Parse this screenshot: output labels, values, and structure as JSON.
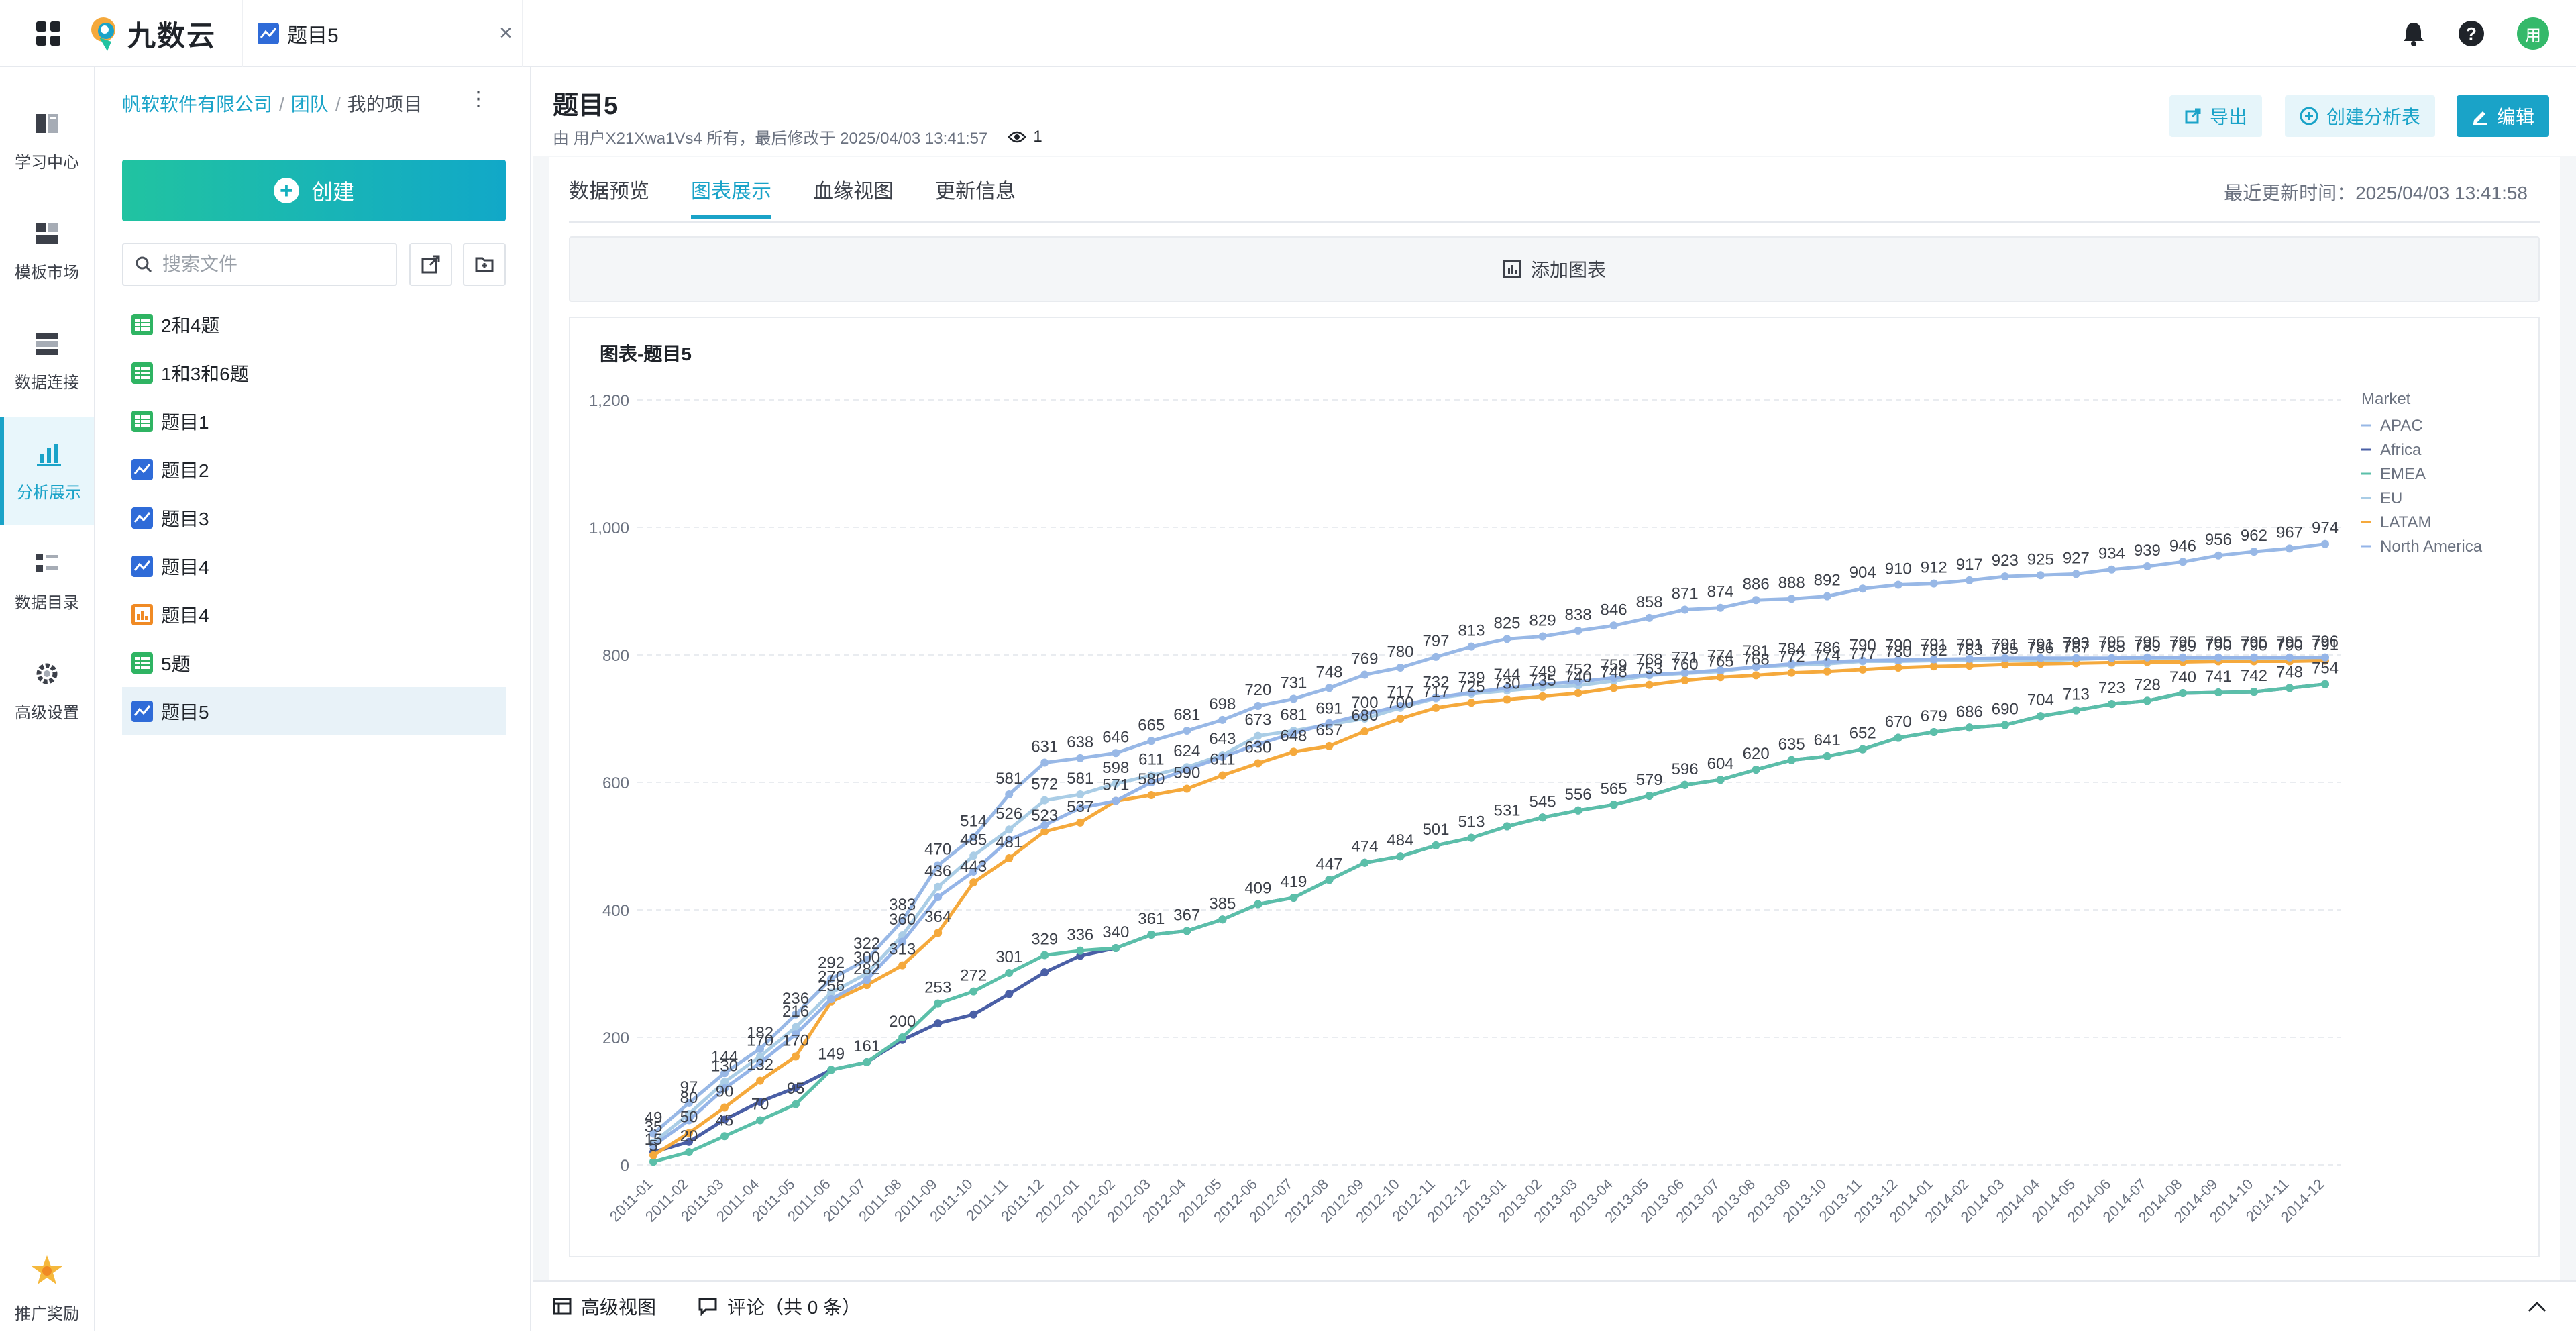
{
  "app": {
    "logo_text": "九数云",
    "tab_title": "题目5"
  },
  "rail": {
    "items": [
      {
        "label": "学习中心",
        "icon": "book-icon"
      },
      {
        "label": "模板市场",
        "icon": "template-icon"
      },
      {
        "label": "数据连接",
        "icon": "database-icon"
      },
      {
        "label": "分析展示",
        "icon": "analysis-icon",
        "active": true
      },
      {
        "label": "数据目录",
        "icon": "catalog-icon"
      },
      {
        "label": "高级设置",
        "icon": "gear-icon"
      },
      {
        "label": "推广奖励",
        "icon": "star-icon"
      }
    ]
  },
  "panel": {
    "breadcrumb": {
      "org": "帆软软件有限公司",
      "team": "团队",
      "project": "我的项目",
      "sep": "/"
    },
    "create_label": "创建",
    "search_placeholder": "搜索文件",
    "files": [
      {
        "name": "2和4题",
        "type": "table"
      },
      {
        "name": "1和3和6题",
        "type": "table"
      },
      {
        "name": "题目1",
        "type": "table"
      },
      {
        "name": "题目2",
        "type": "chart"
      },
      {
        "name": "题目3",
        "type": "chart"
      },
      {
        "name": "题目4",
        "type": "chart"
      },
      {
        "name": "题目4",
        "type": "dashboard"
      },
      {
        "name": "5题",
        "type": "table"
      },
      {
        "name": "题目5",
        "type": "chart",
        "active": true
      }
    ]
  },
  "header": {
    "title": "题目5",
    "meta": "由 用户X21Xwa1Vs4 所有，最后修改于 2025/04/03 13:41:57",
    "views": "1",
    "export_label": "导出",
    "create_analysis_label": "创建分析表",
    "edit_label": "编辑"
  },
  "tabs": [
    "数据预览",
    "图表展示",
    "血缘视图",
    "更新信息"
  ],
  "active_tab": "图表展示",
  "updated": "最近更新时间：2025/04/03 13:41:58",
  "add_chart_label": "添加图表",
  "bottom": {
    "advanced_view": "高级视图",
    "comments": "评论（共 0 条）"
  },
  "colors": {
    "accent": "#1aa3c8",
    "APAC": "#98b8e6",
    "Africa": "#4a5fa6",
    "EMEA": "#5bbfa9",
    "EU": "#aacde6",
    "LATAM": "#f5a93c",
    "North America": "#95b5e8"
  },
  "chart_data": {
    "type": "line",
    "title": "图表-题目5",
    "legend_title": "Market",
    "legend_position": "top-right",
    "ylim": [
      0,
      1200
    ],
    "y_ticks": [
      "0",
      "200",
      "400",
      "600",
      "800",
      "1,000",
      "1,200"
    ],
    "grid": true,
    "categories": [
      "2011-01",
      "2011-02",
      "2011-03",
      "2011-04",
      "2011-05",
      "2011-06",
      "2011-07",
      "2011-08",
      "2011-09",
      "2011-10",
      "2011-11",
      "2011-12",
      "2012-01",
      "2012-02",
      "2012-03",
      "2012-04",
      "2012-05",
      "2012-06",
      "2012-07",
      "2012-08",
      "2012-09",
      "2012-10",
      "2012-11",
      "2012-12",
      "2013-01",
      "2013-02",
      "2013-03",
      "2013-04",
      "2013-05",
      "2013-06",
      "2013-07",
      "2013-08",
      "2013-09",
      "2013-10",
      "2013-11",
      "2013-12",
      "2014-01",
      "2014-02",
      "2014-03",
      "2014-04",
      "2014-05",
      "2014-06",
      "2014-07",
      "2014-08",
      "2014-09",
      "2014-10",
      "2014-11",
      "2014-12"
    ],
    "series": [
      {
        "name": "APAC",
        "values": [
          49,
          97,
          144,
          182,
          236,
          292,
          322,
          383,
          470,
          514,
          581,
          631,
          638,
          646,
          665,
          681,
          698,
          720,
          731,
          748,
          769,
          780,
          797,
          813,
          825,
          829,
          838,
          846,
          858,
          871,
          874,
          886,
          888,
          892,
          904,
          910,
          912,
          917,
          923,
          925,
          927,
          934,
          939,
          946,
          956,
          962,
          967,
          974
        ],
        "labels": true
      },
      {
        "name": "Africa",
        "values": [
          20,
          36,
          71,
          99,
          121,
          149,
          161,
          196,
          222,
          236,
          268,
          302,
          328,
          340,
          361,
          367,
          385,
          409,
          419,
          447,
          474,
          484,
          501,
          513,
          531,
          545,
          556,
          565,
          579,
          596,
          604,
          620,
          635,
          641,
          652,
          670,
          679,
          686,
          690,
          704,
          713,
          723,
          728,
          740,
          741,
          742,
          748,
          754
        ],
        "labels": false
      },
      {
        "name": "EMEA",
        "values": [
          5,
          20,
          45,
          70,
          95,
          149,
          161,
          200,
          253,
          272,
          301,
          329,
          336,
          340,
          361,
          367,
          385,
          409,
          419,
          447,
          474,
          484,
          501,
          513,
          531,
          545,
          556,
          565,
          579,
          596,
          604,
          620,
          635,
          641,
          652,
          670,
          679,
          686,
          690,
          704,
          713,
          723,
          728,
          740,
          741,
          742,
          748,
          754
        ],
        "labels": true
      },
      {
        "name": "EU",
        "values": [
          35,
          80,
          130,
          170,
          216,
          270,
          300,
          360,
          436,
          485,
          526,
          572,
          581,
          598,
          611,
          624,
          643,
          673,
          681,
          691,
          700,
          717,
          732,
          739,
          744,
          749,
          752,
          759,
          768,
          771,
          774,
          781,
          784,
          786,
          790,
          790,
          791,
          791,
          791,
          791,
          793,
          795,
          795,
          795,
          795,
          795,
          795,
          796
        ],
        "labels": true
      },
      {
        "name": "LATAM",
        "values": [
          15,
          50,
          90,
          132,
          170,
          256,
          282,
          313,
          364,
          443,
          481,
          523,
          537,
          571,
          580,
          590,
          611,
          630,
          648,
          657,
          680,
          700,
          717,
          725,
          730,
          735,
          740,
          748,
          753,
          760,
          765,
          768,
          772,
          774,
          777,
          780,
          782,
          783,
          785,
          786,
          787,
          788,
          789,
          789,
          790,
          790,
          790,
          791
        ],
        "labels": true
      },
      {
        "name": "North America",
        "values": [
          30,
          70,
          120,
          160,
          205,
          260,
          290,
          350,
          420,
          460,
          510,
          533,
          560,
          571,
          600,
          620,
          640,
          660,
          677,
          693,
          707,
          720,
          733,
          741,
          748,
          754,
          758,
          764,
          769,
          772,
          776,
          781,
          786,
          789,
          791,
          792,
          793,
          794,
          795,
          795,
          795,
          795,
          796,
          796,
          796,
          796,
          796,
          796
        ],
        "labels": false
      }
    ]
  }
}
